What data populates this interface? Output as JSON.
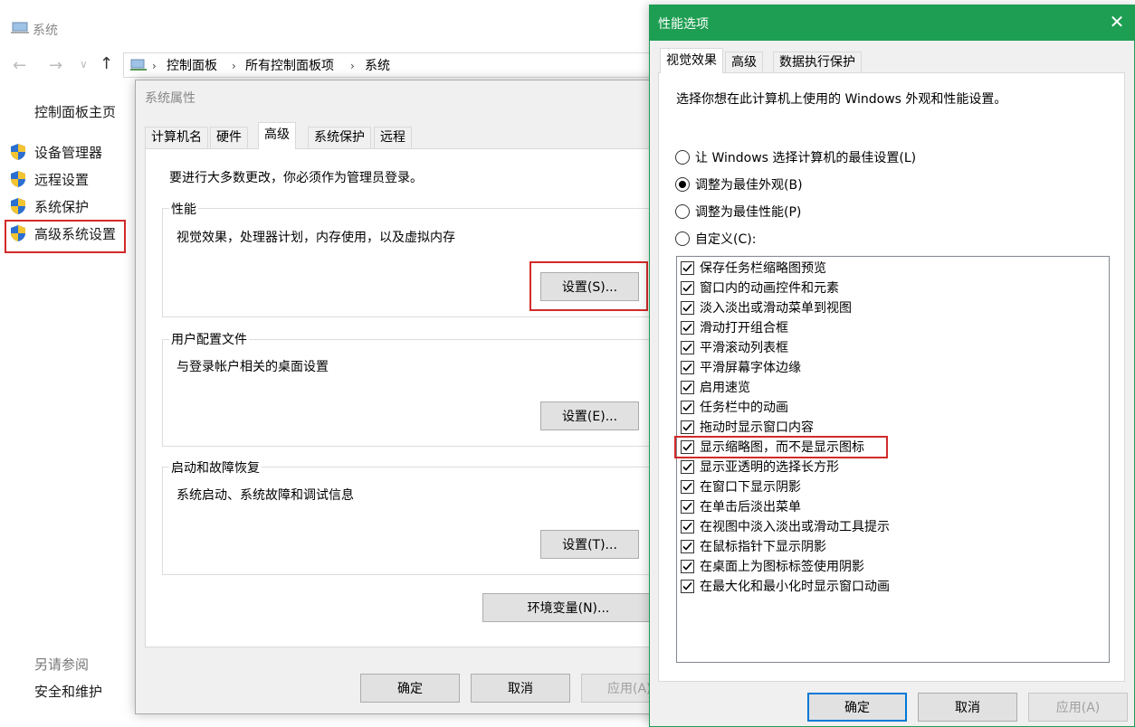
{
  "system_window": {
    "title": "系统",
    "breadcrumb": [
      "控制面板",
      "所有控制面板项",
      "系统"
    ],
    "nav_home": "控制面板主页",
    "side_items": [
      "设备管理器",
      "远程设置",
      "系统保护",
      "高级系统设置"
    ],
    "see_also": "另请参阅",
    "security": "安全和维护"
  },
  "system_properties": {
    "title": "系统属性",
    "tabs": [
      "计算机名",
      "硬件",
      "高级",
      "系统保护",
      "远程"
    ],
    "active_tab": "高级",
    "admin_note": "要进行大多数更改，你必须作为管理员登录。",
    "groups": [
      {
        "title": "性能",
        "desc": "视觉效果，处理器计划，内存使用，以及虚拟内存",
        "button": "设置(S)..."
      },
      {
        "title": "用户配置文件",
        "desc": "与登录帐户相关的桌面设置",
        "button": "设置(E)..."
      },
      {
        "title": "启动和故障恢复",
        "desc": "系统启动、系统故障和调试信息",
        "button": "设置(T)..."
      }
    ],
    "env_button": "环境变量(N)...",
    "ok": "确定",
    "cancel": "取消",
    "apply": "应用(A)"
  },
  "performance_options": {
    "title": "性能选项",
    "close_icon": "close-icon",
    "tabs": [
      "视觉效果",
      "高级",
      "数据执行保护"
    ],
    "active_tab": "视觉效果",
    "description": "选择你想在此计算机上使用的 Windows 外观和性能设置。",
    "radio_options": [
      {
        "label": "让 Windows 选择计算机的最佳设置(L)",
        "selected": false
      },
      {
        "label": "调整为最佳外观(B)",
        "selected": true
      },
      {
        "label": "调整为最佳性能(P)",
        "selected": false
      },
      {
        "label": "自定义(C):",
        "selected": false
      }
    ],
    "effects": [
      {
        "label": "保存任务栏缩略图预览",
        "checked": true
      },
      {
        "label": "窗口内的动画控件和元素",
        "checked": true
      },
      {
        "label": "淡入淡出或滑动菜单到视图",
        "checked": true
      },
      {
        "label": "滑动打开组合框",
        "checked": true
      },
      {
        "label": "平滑滚动列表框",
        "checked": true
      },
      {
        "label": "平滑屏幕字体边缘",
        "checked": true
      },
      {
        "label": "启用速览",
        "checked": true
      },
      {
        "label": "任务栏中的动画",
        "checked": true
      },
      {
        "label": "拖动时显示窗口内容",
        "checked": true
      },
      {
        "label": "显示缩略图，而不是显示图标",
        "checked": true
      },
      {
        "label": "显示亚透明的选择长方形",
        "checked": true
      },
      {
        "label": "在窗口下显示阴影",
        "checked": true
      },
      {
        "label": "在单击后淡出菜单",
        "checked": true
      },
      {
        "label": "在视图中淡入淡出或滑动工具提示",
        "checked": true
      },
      {
        "label": "在鼠标指针下显示阴影",
        "checked": true
      },
      {
        "label": "在桌面上为图标标签使用阴影",
        "checked": true
      },
      {
        "label": "在最大化和最小化时显示窗口动画",
        "checked": true
      }
    ],
    "ok": "确定",
    "cancel": "取消",
    "apply": "应用(A)"
  },
  "colors": {
    "accent_green": "#1e9e52",
    "highlight_red": "#d32a2a",
    "primary_blue": "#0078d7"
  }
}
